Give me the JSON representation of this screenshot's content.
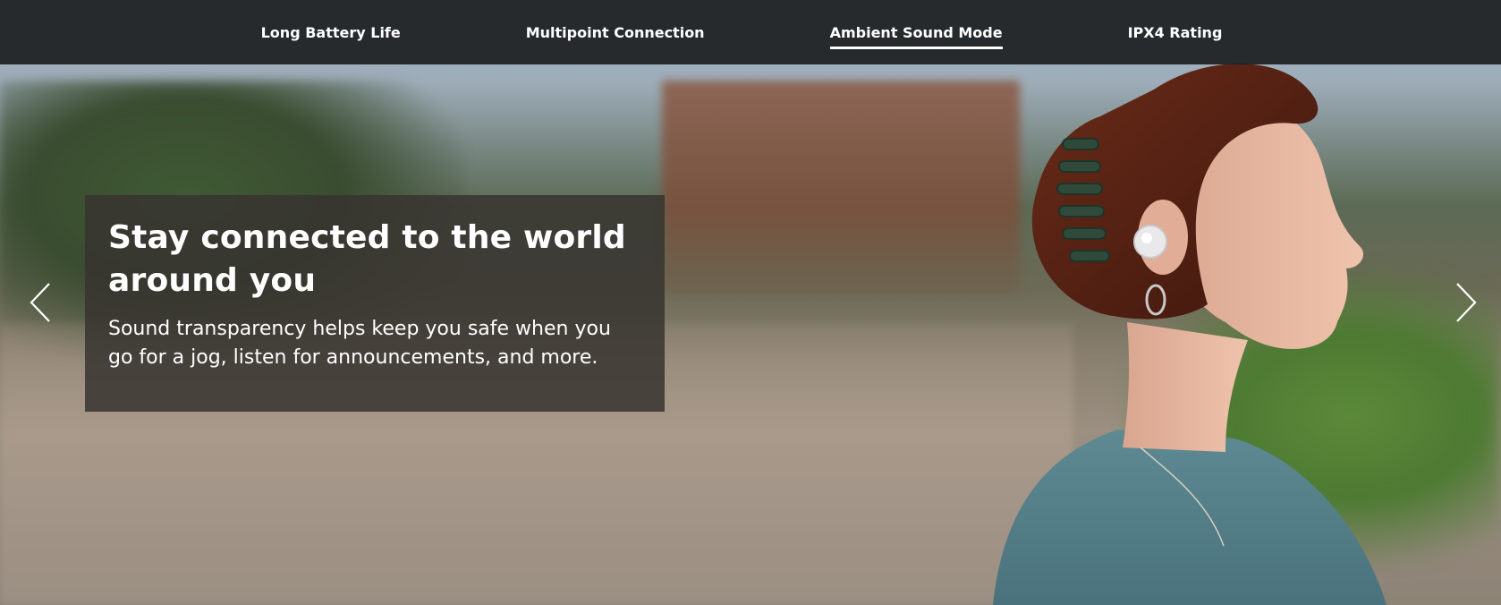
{
  "nav": {
    "tabs": [
      {
        "label": "Long Battery Life",
        "active": false
      },
      {
        "label": "Multipoint Connection",
        "active": false
      },
      {
        "label": "Ambient Sound Mode",
        "active": true
      },
      {
        "label": "IPX4 Rating",
        "active": false
      }
    ]
  },
  "slide": {
    "heading": "Stay connected to the world around you",
    "body": "Sound transparency helps keep you safe when you go for a jog, listen for announcements, and more."
  },
  "controls": {
    "prev_icon": "chevron-left-icon",
    "next_icon": "chevron-right-icon"
  },
  "colors": {
    "nav_bg": "#1c1e20",
    "caption_bg": "#37342f",
    "text": "#ffffff"
  }
}
